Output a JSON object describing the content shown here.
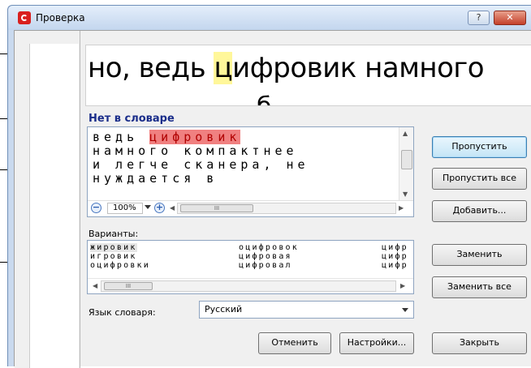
{
  "window": {
    "title": "Проверка",
    "help_label": "?",
    "close_label": "✕"
  },
  "context": {
    "before": "но, ведь ",
    "highlight": "ц",
    "after": "ифровик намного",
    "next_line_fragment": "б"
  },
  "status": {
    "not_found_label": "Нет в словаре"
  },
  "editor": {
    "line1_pre": "ведь ",
    "line1_err": "цифровик",
    "line2": "намного компактнее",
    "line3": "и легче сканера, не",
    "line4": "нуждается в",
    "zoom_value": "100%",
    "scroll_thumb_glyph": "III"
  },
  "suggestions": {
    "label": "Варианты:",
    "columns": [
      [
        "жировик",
        "игровик",
        "оцифровки"
      ],
      [
        "оцифровок",
        "цифровая",
        "цифровал"
      ],
      [
        "цифр",
        "цифр",
        "цифр"
      ]
    ],
    "selected_index": 0,
    "scroll_thumb_glyph": "III"
  },
  "language": {
    "label": "Язык словаря:",
    "value": "Русский"
  },
  "buttons": {
    "skip": "Пропустить",
    "skip_all": "Пропустить все",
    "add": "Добавить...",
    "replace": "Заменить",
    "replace_all": "Заменить все",
    "undo": "Отменить",
    "settings": "Настройки...",
    "close": "Закрыть"
  },
  "colors": {
    "error_highlight": "#f08080",
    "context_highlight": "#fff79a",
    "not_found_text": "#1a2d8a"
  }
}
